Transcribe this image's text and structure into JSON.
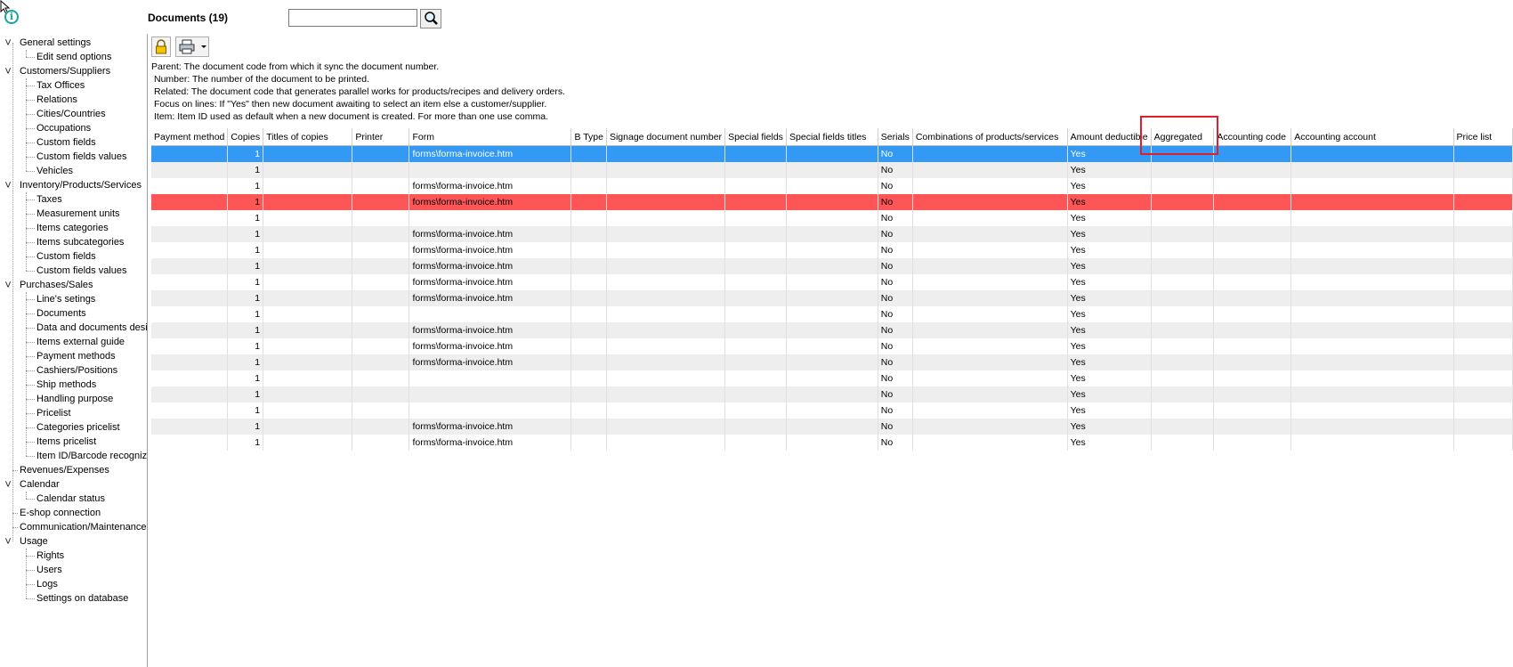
{
  "header": {
    "title": "Documents (19)",
    "search_placeholder": ""
  },
  "sidebar": {
    "items": [
      {
        "label": "General settings",
        "level": 0,
        "expanded": true
      },
      {
        "label": "Edit send options",
        "level": 1
      },
      {
        "label": "Customers/Suppliers",
        "level": 0,
        "expanded": true
      },
      {
        "label": "Tax Offices",
        "level": 1
      },
      {
        "label": "Relations",
        "level": 1
      },
      {
        "label": "Cities/Countries",
        "level": 1
      },
      {
        "label": "Occupations",
        "level": 1
      },
      {
        "label": "Custom fields",
        "level": 1
      },
      {
        "label": "Custom fields values",
        "level": 1
      },
      {
        "label": "Vehicles",
        "level": 1
      },
      {
        "label": "Inventory/Products/Services",
        "level": 0,
        "expanded": true
      },
      {
        "label": "Taxes",
        "level": 1
      },
      {
        "label": "Measurement units",
        "level": 1
      },
      {
        "label": "Items categories",
        "level": 1
      },
      {
        "label": "Items subcategories",
        "level": 1
      },
      {
        "label": "Custom fields",
        "level": 1
      },
      {
        "label": "Custom fields values",
        "level": 1
      },
      {
        "label": "Purchases/Sales",
        "level": 0,
        "expanded": true
      },
      {
        "label": "Line's setings",
        "level": 1
      },
      {
        "label": "Documents",
        "level": 1
      },
      {
        "label": "Data and documents design",
        "level": 1
      },
      {
        "label": "Items external guide",
        "level": 1
      },
      {
        "label": "Payment methods",
        "level": 1
      },
      {
        "label": "Cashiers/Positions",
        "level": 1
      },
      {
        "label": "Ship methods",
        "level": 1
      },
      {
        "label": "Handling purpose",
        "level": 1
      },
      {
        "label": "Pricelist",
        "level": 1
      },
      {
        "label": "Categories pricelist",
        "level": 1
      },
      {
        "label": "Items pricelist",
        "level": 1
      },
      {
        "label": "Item ID/Barcode recognizer",
        "level": 1
      },
      {
        "label": "Revenues/Expenses",
        "level": 0
      },
      {
        "label": "Calendar",
        "level": 0,
        "expanded": true
      },
      {
        "label": "Calendar status",
        "level": 1
      },
      {
        "label": "E-shop connection",
        "level": 0
      },
      {
        "label": "Communication/Maintenance",
        "level": 0
      },
      {
        "label": "Usage",
        "level": 0,
        "expanded": true
      },
      {
        "label": "Rights",
        "level": 1
      },
      {
        "label": "Users",
        "level": 1
      },
      {
        "label": "Logs",
        "level": 1
      },
      {
        "label": "Settings on database",
        "level": 1
      }
    ]
  },
  "toolbar": {
    "lock_icon": "lock-icon",
    "print_icon": "printer-icon",
    "dropdown_icon": "dropdown-arrow-icon"
  },
  "help_lines": [
    "Parent: The document code from which it sync the document number.",
    "Number: The number of the document to be printed.",
    "Related: The document code that generates parallel works for products/recipes and delivery orders.",
    "Focus on lines: If \"Yes\" then new document awaiting to select an item else a customer/supplier.",
    "Item: Item ID used as default when a new document is created. For more than one use comma."
  ],
  "table": {
    "columns": [
      "Payment method",
      "Copies",
      "Titles of copies",
      "Printer",
      "Form",
      "B Type",
      "Signage document number",
      "Special fields",
      "Special fields titles",
      "Serials",
      "Combinations of products/services",
      "Amount deductible",
      "Aggregated",
      "Accounting code",
      "Accounting account",
      "Price list"
    ],
    "rows": [
      {
        "copies": "1",
        "form": "forms\\forma-invoice.htm",
        "serials": "No",
        "amount": "Yes",
        "state": "selected"
      },
      {
        "copies": "1",
        "form": "",
        "serials": "No",
        "amount": "Yes",
        "state": "odd"
      },
      {
        "copies": "1",
        "form": "forms\\forma-invoice.htm",
        "serials": "No",
        "amount": "Yes",
        "state": "even"
      },
      {
        "copies": "1",
        "form": "forms\\forma-invoice.htm",
        "serials": "No",
        "amount": "Yes",
        "state": "red"
      },
      {
        "copies": "1",
        "form": "",
        "serials": "No",
        "amount": "Yes",
        "state": "even"
      },
      {
        "copies": "1",
        "form": "forms\\forma-invoice.htm",
        "serials": "No",
        "amount": "Yes",
        "state": "odd"
      },
      {
        "copies": "1",
        "form": "forms\\forma-invoice.htm",
        "serials": "No",
        "amount": "Yes",
        "state": "even"
      },
      {
        "copies": "1",
        "form": "forms\\forma-invoice.htm",
        "serials": "No",
        "amount": "Yes",
        "state": "odd"
      },
      {
        "copies": "1",
        "form": "forms\\forma-invoice.htm",
        "serials": "No",
        "amount": "Yes",
        "state": "even"
      },
      {
        "copies": "1",
        "form": "forms\\forma-invoice.htm",
        "serials": "No",
        "amount": "Yes",
        "state": "odd"
      },
      {
        "copies": "1",
        "form": "",
        "serials": "No",
        "amount": "Yes",
        "state": "even"
      },
      {
        "copies": "1",
        "form": "forms\\forma-invoice.htm",
        "serials": "No",
        "amount": "Yes",
        "state": "odd"
      },
      {
        "copies": "1",
        "form": "forms\\forma-invoice.htm",
        "serials": "No",
        "amount": "Yes",
        "state": "even"
      },
      {
        "copies": "1",
        "form": "forms\\forma-invoice.htm",
        "serials": "No",
        "amount": "Yes",
        "state": "odd"
      },
      {
        "copies": "1",
        "form": "",
        "serials": "No",
        "amount": "Yes",
        "state": "even"
      },
      {
        "copies": "1",
        "form": "",
        "serials": "No",
        "amount": "Yes",
        "state": "odd"
      },
      {
        "copies": "1",
        "form": "",
        "serials": "No",
        "amount": "Yes",
        "state": "even"
      },
      {
        "copies": "1",
        "form": "forms\\forma-invoice.htm",
        "serials": "No",
        "amount": "Yes",
        "state": "odd"
      },
      {
        "copies": "1",
        "form": "forms\\forma-invoice.htm",
        "serials": "No",
        "amount": "Yes",
        "state": "even"
      }
    ]
  },
  "colors": {
    "selected_row": "#3399f3",
    "red_row": "#fe5656",
    "highlight_box": "#e01e2e",
    "info_icon": "#1aa5a0"
  }
}
